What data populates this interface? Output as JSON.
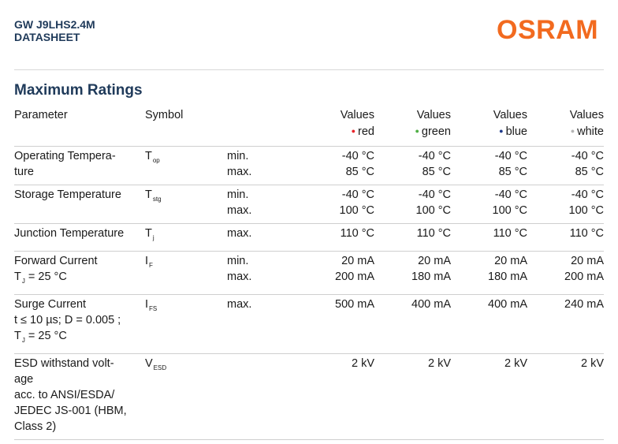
{
  "header": {
    "product": "GW J9LHS2.4M",
    "doctype": "DATASHEET",
    "logo": "OSRAM",
    "logo_color": "#f26a1f"
  },
  "section_title": "Maximum Ratings",
  "columns": {
    "parameter": "Parameter",
    "symbol": "Symbol",
    "values": "Values",
    "colors": [
      {
        "name": "red",
        "dot": "#e8242b"
      },
      {
        "name": "green",
        "dot": "#4fae44"
      },
      {
        "name": "blue",
        "dot": "#1f3a8a"
      },
      {
        "name": "white",
        "dot": "#b5b5b5"
      }
    ]
  },
  "rows": [
    {
      "param": [
        "Operating Tempera-",
        "ture"
      ],
      "sym": "T",
      "sub": "op",
      "limits": [
        "min.",
        "max."
      ],
      "values": [
        [
          "-40 °C",
          "85 °C"
        ],
        [
          "-40 °C",
          "85 °C"
        ],
        [
          "-40 °C",
          "85 °C"
        ],
        [
          "-40 °C",
          "85 °C"
        ]
      ]
    },
    {
      "param": [
        "Storage Temperature"
      ],
      "sym": "T",
      "sub": "stg",
      "limits": [
        "min.",
        "max."
      ],
      "values": [
        [
          "-40 °C",
          "100 °C"
        ],
        [
          "-40 °C",
          "100 °C"
        ],
        [
          "-40 °C",
          "100 °C"
        ],
        [
          "-40 °C",
          "100 °C"
        ]
      ]
    },
    {
      "param": [
        "Junction Temperature"
      ],
      "sym": "T",
      "sub": "j",
      "limits": [
        "max."
      ],
      "values": [
        [
          "110 °C"
        ],
        [
          "110 °C"
        ],
        [
          "110 °C"
        ],
        [
          "110 °C"
        ]
      ]
    },
    {
      "param": [
        "Forward Current",
        "T_J = 25 °C"
      ],
      "sym": "I",
      "sub": "F",
      "limits": [
        "min.",
        "max."
      ],
      "values": [
        [
          "20 mA",
          "200 mA"
        ],
        [
          "20 mA",
          "180 mA"
        ],
        [
          "20 mA",
          "180 mA"
        ],
        [
          "20 mA",
          "200 mA"
        ]
      ]
    },
    {
      "param": [
        "Surge Current",
        "t ≤ 10 µs; D = 0.005 ;",
        "T_J = 25 °C"
      ],
      "sym": "I",
      "sub": "FS",
      "limits": [
        "max."
      ],
      "values": [
        [
          "500 mA"
        ],
        [
          "400 mA"
        ],
        [
          "400 mA"
        ],
        [
          "240 mA"
        ]
      ]
    },
    {
      "param": [
        "ESD withstand volt-",
        "age",
        "acc. to ANSI/ESDA/",
        "JEDEC JS-001 (HBM,",
        "Class 2)"
      ],
      "sym": "V",
      "sub": "ESD",
      "limits": [
        ""
      ],
      "values": [
        [
          "2 kV"
        ],
        [
          "2 kV"
        ],
        [
          "2 kV"
        ],
        [
          "2 kV"
        ]
      ]
    }
  ]
}
